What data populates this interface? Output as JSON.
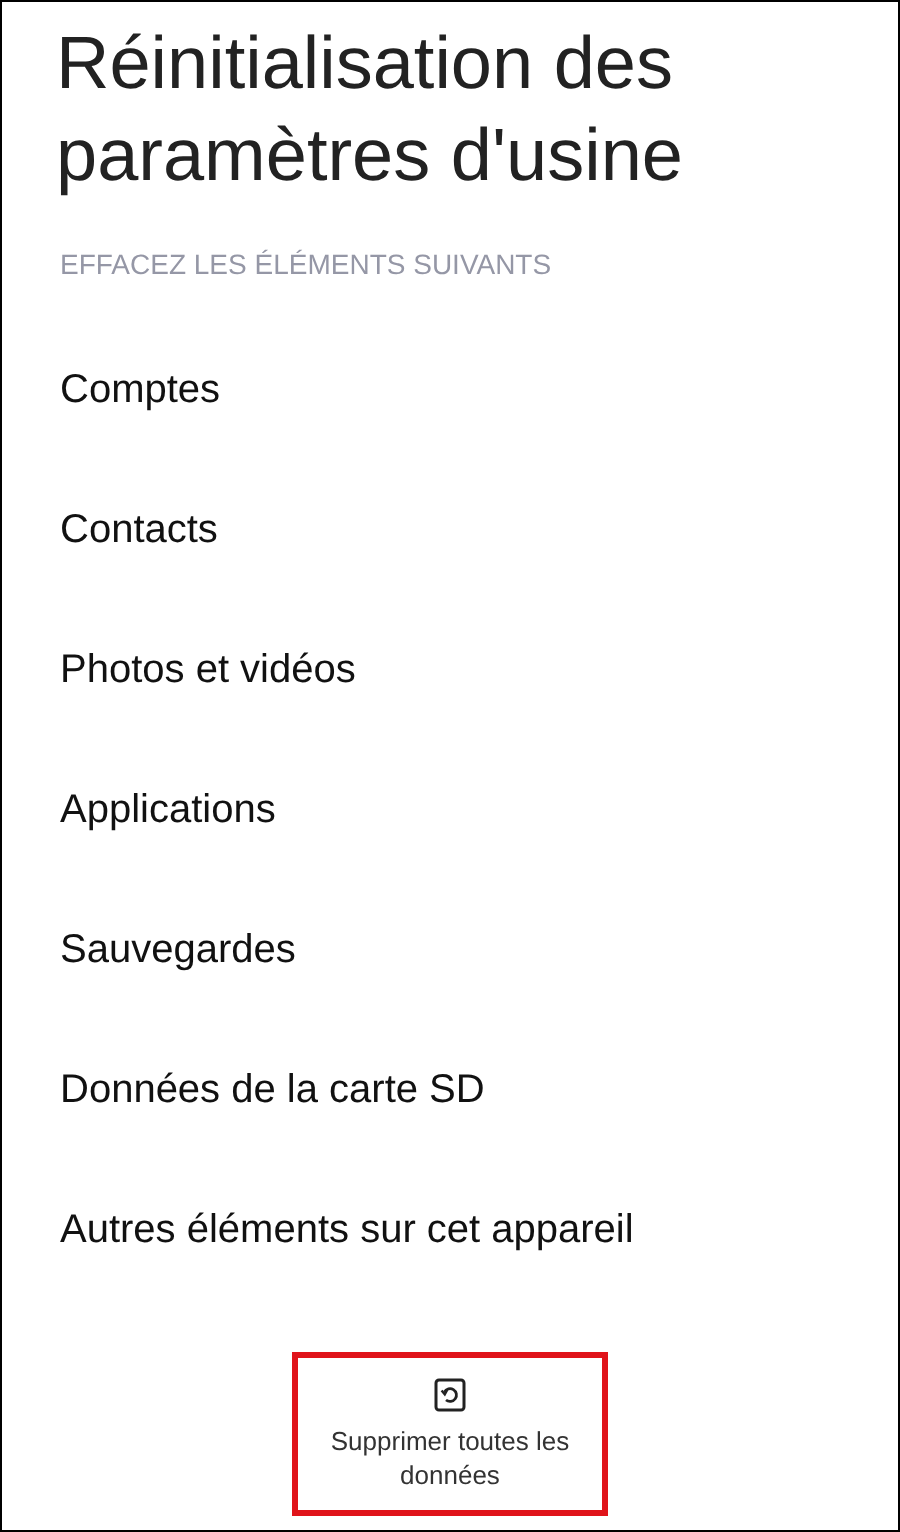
{
  "title": "Réinitialisation des paramètres d'usine",
  "section_header": "EFFACEZ LES ÉLÉMENTS SUIVANTS",
  "items": [
    "Comptes",
    "Contacts",
    "Photos et vidéos",
    "Applications",
    "Sauvegardes",
    "Données de la carte SD",
    "Autres éléments sur cet appareil"
  ],
  "action_button": {
    "label": "Supprimer toutes les données",
    "highlighted": true
  }
}
